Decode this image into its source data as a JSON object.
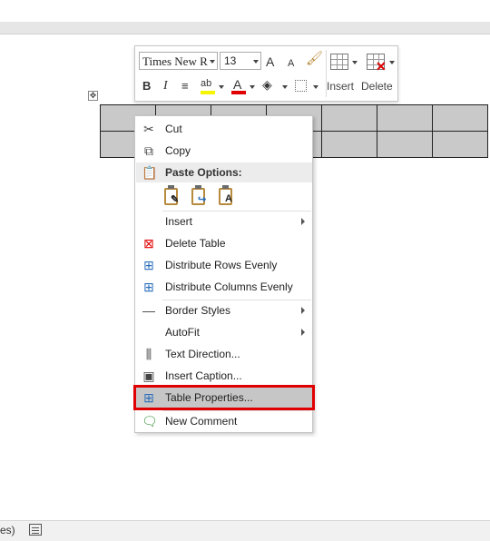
{
  "status": {
    "left_text": "es)"
  },
  "mini_toolbar": {
    "font_name": "Times New Rc",
    "font_size": "13",
    "grow_font": "A",
    "shrink_font": "A",
    "bold": "B",
    "italic": "I",
    "insert_label": "Insert",
    "delete_label": "Delete"
  },
  "move_handle": "✥",
  "context_menu": {
    "items": [
      {
        "label": "Cut",
        "icon": "scissors-icon"
      },
      {
        "label": "Copy",
        "icon": "copy-icon"
      },
      {
        "label": "Paste Options:",
        "icon": "clipboard-icon"
      },
      {
        "label": "Insert",
        "icon": ""
      },
      {
        "label": "Delete Table",
        "icon": "delete-table-icon"
      },
      {
        "label": "Distribute Rows Evenly",
        "icon": "distribute-rows-icon"
      },
      {
        "label": "Distribute Columns Evenly",
        "icon": "distribute-columns-icon"
      },
      {
        "label": "Border Styles",
        "icon": "border-line-icon"
      },
      {
        "label": "AutoFit",
        "icon": ""
      },
      {
        "label": "Text Direction...",
        "icon": "text-direction-icon"
      },
      {
        "label": "Insert Caption...",
        "icon": "insert-caption-icon"
      },
      {
        "label": "Table Properties...",
        "icon": "table-properties-icon"
      },
      {
        "label": "New Comment",
        "icon": "comment-icon"
      }
    ],
    "paste_glyphs": [
      "✎",
      "↪",
      "A"
    ]
  },
  "colors": {
    "highlight_border": "#e00000",
    "selected_bg": "#c6c6c6",
    "table_cell_bg": "#c9c9c9"
  }
}
